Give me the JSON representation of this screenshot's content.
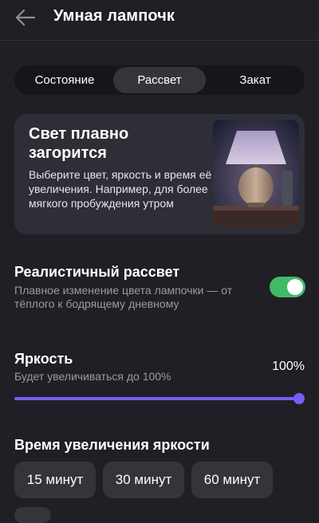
{
  "header": {
    "title": "Умная лампочк",
    "back_icon": "arrow-left-icon"
  },
  "tabs": [
    {
      "label": "Состояние",
      "active": false
    },
    {
      "label": "Рассвет",
      "active": true
    },
    {
      "label": "Закат",
      "active": false
    }
  ],
  "info_card": {
    "title": "Свет плавно загорится",
    "description": "Выберите цвет, яркость и время её увеличения. Например, для более мягкого пробуждения утром",
    "image": "table-lamp-illustration"
  },
  "realistic_sunrise": {
    "title": "Реалистичный рассвет",
    "description": "Плавное изменение цвета лампочки — от тёплого к бодрящему дневному",
    "enabled": true
  },
  "brightness": {
    "title": "Яркость",
    "description": "Будет увеличиваться до 100%",
    "value_label": "100%",
    "level": 1.0
  },
  "duration": {
    "title": "Время увеличения яркости",
    "options": [
      "15 минут",
      "30 минут",
      "60 минут"
    ]
  },
  "colors": {
    "background": "#1f1f25",
    "card": "#2e2e36",
    "toggle_on": "#3fba66",
    "slider": "#7a5cf5"
  }
}
